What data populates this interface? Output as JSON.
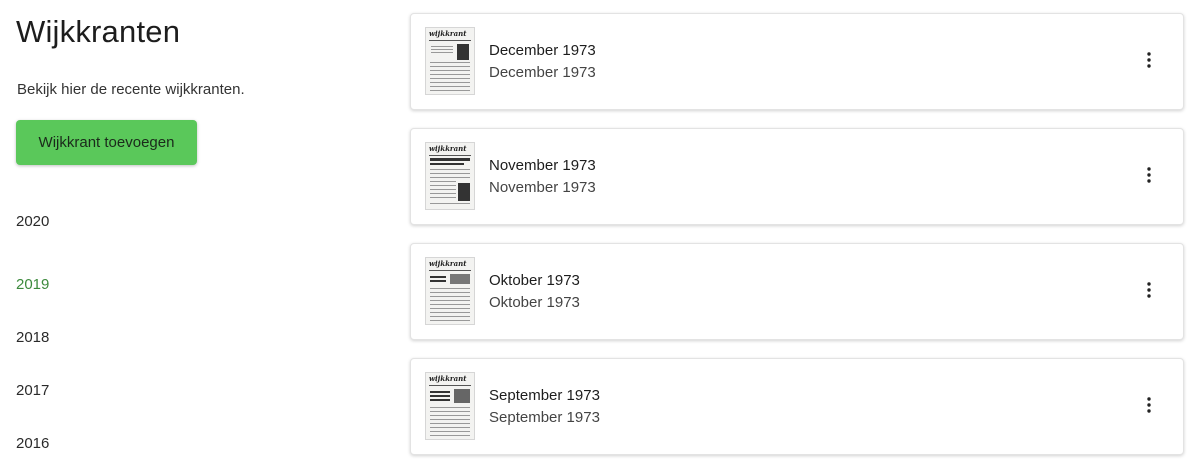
{
  "header": {
    "title": "Wijkkranten",
    "subtitle": "Bekijk hier de recente wijkkranten.",
    "add_label": "Wijkkrant toevoegen"
  },
  "years": [
    {
      "label": "2020",
      "active": false
    },
    {
      "label": "2019",
      "active": true
    },
    {
      "label": "2018",
      "active": false
    },
    {
      "label": "2017",
      "active": false
    },
    {
      "label": "2016",
      "active": false
    }
  ],
  "editions": [
    {
      "title": "December 1973",
      "subtitle": "December 1973",
      "thumb_masthead": "wijkkrant"
    },
    {
      "title": "November 1973",
      "subtitle": "November 1973",
      "thumb_masthead": "wijkkrant"
    },
    {
      "title": "Oktober 1973",
      "subtitle": "Oktober 1973",
      "thumb_masthead": "wijkkrant"
    },
    {
      "title": "September 1973",
      "subtitle": "September 1973",
      "thumb_masthead": "wijkkrant"
    }
  ],
  "colors": {
    "accent_button": "#5ac85a",
    "active_year": "#3c8a3c"
  },
  "icons": {
    "menu": "more-vertical-icon",
    "thumbnail": "newspaper-thumbnail"
  }
}
